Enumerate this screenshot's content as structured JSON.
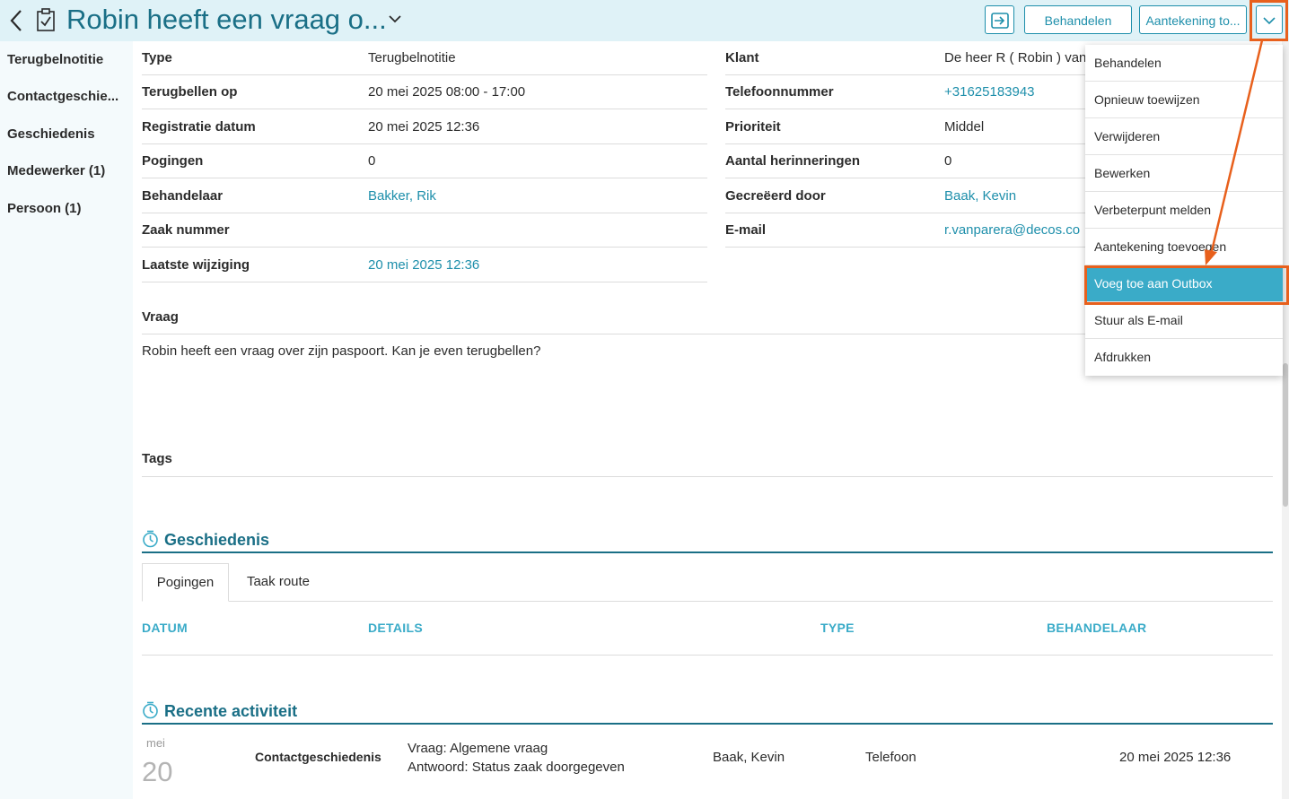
{
  "header": {
    "title": "Robin heeft een vraag o...",
    "buttons": {
      "handle": "Behandelen",
      "note": "Aantekening to..."
    }
  },
  "sidebar": {
    "items": [
      {
        "label": "Terugbelnotitie"
      },
      {
        "label": "Contactgeschie..."
      },
      {
        "label": "Geschiedenis"
      },
      {
        "label": "Medewerker (1)"
      },
      {
        "label": "Persoon (1)"
      }
    ]
  },
  "fields_left": [
    {
      "label": "Type",
      "value": "Terugbelnotitie"
    },
    {
      "label": "Terugbellen op",
      "value": "20 mei 2025 08:00 - 17:00"
    },
    {
      "label": "Registratie datum",
      "value": "20 mei 2025 12:36"
    },
    {
      "label": "Pogingen",
      "value": "0"
    },
    {
      "label": "Behandelaar",
      "value": "Bakker, Rik"
    },
    {
      "label": "Zaak nummer",
      "value": ""
    },
    {
      "label": "Laatste wijziging",
      "value": "20 mei 2025 12:36"
    }
  ],
  "fields_right": [
    {
      "label": "Klant",
      "value": "De heer R ( Robin ) van"
    },
    {
      "label": "Telefoonnummer",
      "value": "+31625183943"
    },
    {
      "label": "Prioriteit",
      "value": "Middel"
    },
    {
      "label": "Aantal herinneringen",
      "value": "0"
    },
    {
      "label": "Gecreëerd door",
      "value": "Baak, Kevin"
    },
    {
      "label": "E-mail",
      "value": "r.vanparera@decos.co"
    }
  ],
  "question": {
    "label": "Vraag",
    "text": "Robin heeft een vraag over zijn paspoort. Kan je even terugbellen?"
  },
  "tags": {
    "label": "Tags"
  },
  "history": {
    "title": "Geschiedenis",
    "tabs": [
      "Pogingen",
      "Taak route"
    ],
    "columns": [
      "DATUM",
      "DETAILS",
      "TYPE",
      "BEHANDELAAR"
    ]
  },
  "recent": {
    "title": "Recente activiteit",
    "items": [
      {
        "month": "mei",
        "day": "20",
        "category": "Contactgeschiedenis",
        "line1": "Vraag: Algemene vraag",
        "line2": "Antwoord: Status zaak doorgegeven",
        "person": "Baak, Kevin",
        "channel": "Telefoon",
        "datetime": "20 mei 2025 12:36"
      }
    ]
  },
  "dropdown": {
    "items": [
      "Behandelen",
      "Opnieuw toewijzen",
      "Verwijderen",
      "Bewerken",
      "Verbeterpunt melden",
      "Aantekening toevoegen",
      "Voeg toe aan Outbox",
      "Stuur als E-mail",
      "Afdrukken"
    ],
    "active_item": "Voeg toe aan Outbox"
  },
  "colors": {
    "header_bg": "#dff2f7",
    "accent": "#1e8fab",
    "highlight": "#3aabc8",
    "annotation": "#e8601c"
  }
}
